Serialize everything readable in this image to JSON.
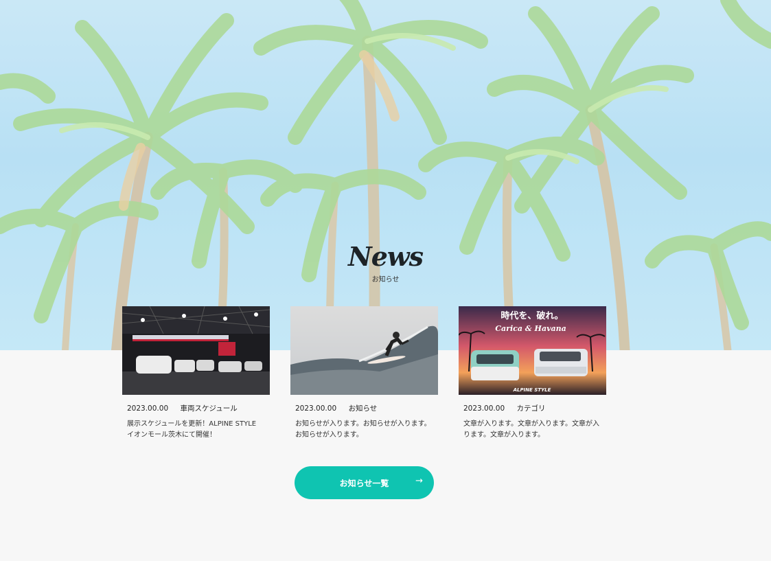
{
  "news_section": {
    "title": "News",
    "subtitle": "お知らせ"
  },
  "cards": [
    {
      "image_alt": "ALPINE STYLE exhibition hall",
      "date": "2023.00.00",
      "category": "車両スケジュール",
      "text": "展示スケジュールを更新！ALPINE STYLE イオンモール茨木にて開催！"
    },
    {
      "image_alt": "surfer riding a wave",
      "date": "2023.00.00",
      "category": "お知らせ",
      "text": "お知らせが入ります。お知らせが入ります。お知らせが入ります。"
    },
    {
      "image_alt": "Carica and Havana vans at sunset",
      "date": "2023.00.00",
      "category": "カテゴリ",
      "text": "文章が入ります。文章が入ります。文章が入ります。文章が入ります。"
    }
  ],
  "poster_text": {
    "headline": "時代を、破れ。",
    "script": "Carica & Havana",
    "brand": "ALPINE STYLE"
  },
  "more_button": {
    "label": "お知らせ一覧",
    "icon": "arrow-right-icon"
  },
  "colors": {
    "accent": "#0fc4b1",
    "background": "#f7f7f7",
    "sky": "#b0dcf3"
  }
}
